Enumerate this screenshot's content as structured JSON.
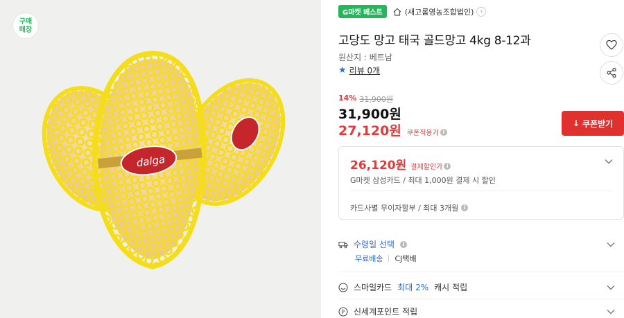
{
  "photo": {
    "store_badge": "구매\n매장",
    "brand_label": "dalga"
  },
  "header": {
    "gbest_badge": "G마켓 베스트",
    "seller_name": "(새고롬영농조합법인)"
  },
  "product": {
    "title": "고당도 망고 태국 골드망고 4kg 8-12과",
    "origin": "원산지 : 베트남",
    "review_label": "리뷰 0개"
  },
  "pricing": {
    "discount_pct": "14%",
    "original_price": "31,900원",
    "price": "31,900원",
    "coupon_price": "27,120원",
    "coupon_note": "쿠폰적용가",
    "coupon_button": "쿠폰받기"
  },
  "payment_box": {
    "pay_price": "26,120원",
    "pay_note": "결제할인가",
    "pay_detail": "G마켓 삼성카드 / 최대 1,000원 결제 시 할인",
    "installment": "카드사별 무이자할부 / 최대 3개월"
  },
  "delivery": {
    "label": "수령일 선택",
    "shipping_fee": "무료배송",
    "carrier": "CJ택배"
  },
  "smilecard": {
    "prefix": "스마일카드",
    "highlight": "최대 2%",
    "suffix": "캐시 적립"
  },
  "ssg": {
    "label": "신세계포인트 적립"
  },
  "colors": {
    "accent_red": "#e0312e",
    "accent_green": "#27b55b",
    "accent_blue": "#2d6be0"
  }
}
